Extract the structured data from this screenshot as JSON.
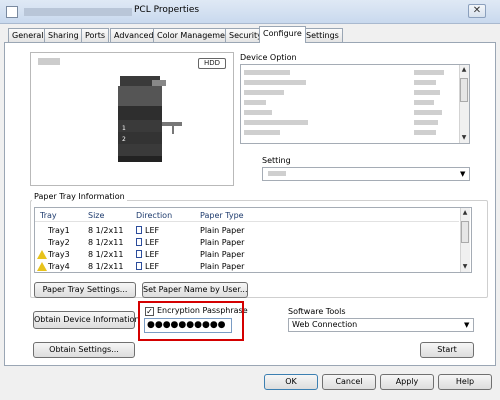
{
  "window": {
    "title": "PCL Properties",
    "close_glyph": "✕"
  },
  "tabs": [
    {
      "label": "General"
    },
    {
      "label": "Sharing"
    },
    {
      "label": "Ports"
    },
    {
      "label": "Advanced"
    },
    {
      "label": "Color Management"
    },
    {
      "label": "Security"
    },
    {
      "label": "Configure",
      "active": true
    },
    {
      "label": "Settings"
    }
  ],
  "preview": {
    "hdd_badge": "HDD"
  },
  "device_option": {
    "label": "Device Option"
  },
  "setting": {
    "label": "Setting"
  },
  "paper_tray": {
    "group_label": "Paper Tray Information",
    "columns": [
      "Tray",
      "Size",
      "Direction",
      "Paper Type"
    ],
    "rows": [
      {
        "tray": "Tray1",
        "size": "8 1/2x11",
        "direction": "LEF",
        "type": "Plain Paper",
        "warning": false
      },
      {
        "tray": "Tray2",
        "size": "8 1/2x11",
        "direction": "LEF",
        "type": "Plain Paper",
        "warning": false
      },
      {
        "tray": "Tray3",
        "size": "8 1/2x11",
        "direction": "LEF",
        "type": "Plain Paper",
        "warning": true
      },
      {
        "tray": "Tray4",
        "size": "8 1/2x11",
        "direction": "LEF",
        "type": "Plain Paper",
        "warning": true
      }
    ],
    "paper_tray_settings_label": "Paper Tray Settings...",
    "set_paper_name_label": "Set Paper Name by User..."
  },
  "obtain_device_info_label": "Obtain Device Information",
  "obtain_settings_label": "Obtain Settings...",
  "encryption": {
    "label": "Encryption Passphrase",
    "checked": true,
    "value": "●●●●●●●●●●"
  },
  "software_tools": {
    "label": "Software Tools",
    "selected": "Web Connection",
    "start_label": "Start"
  },
  "footer": {
    "ok_label": "OK",
    "cancel_label": "Cancel",
    "apply_label": "Apply",
    "help_label": "Help"
  },
  "colors": {
    "highlight": "#d40000",
    "warning": "#e8c31c",
    "tab_border": "#9aa6b4"
  }
}
